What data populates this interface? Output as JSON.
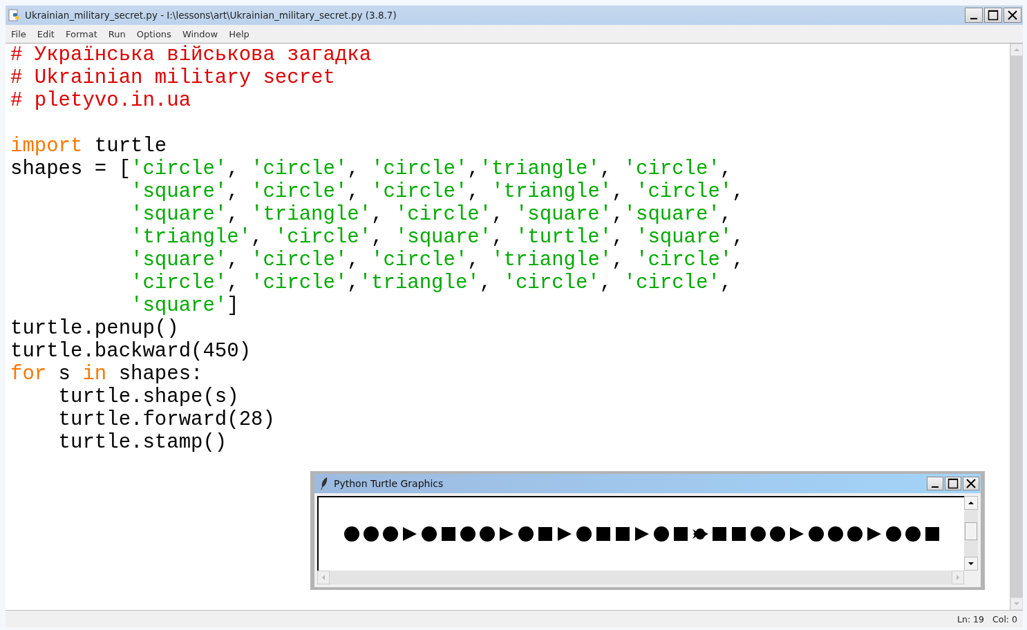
{
  "window": {
    "title": "Ukrainian_military_secret.py - I:\\lessons\\art\\Ukrainian_military_secret.py (3.8.7)"
  },
  "menu": [
    {
      "label": "File"
    },
    {
      "label": "Edit"
    },
    {
      "label": "Format"
    },
    {
      "label": "Run"
    },
    {
      "label": "Options"
    },
    {
      "label": "Window"
    },
    {
      "label": "Help"
    }
  ],
  "editor": {
    "lines": [
      {
        "kind": "code",
        "tokens": [
          {
            "kind": "comment",
            "text": "# Українська військова загадка"
          }
        ]
      },
      {
        "kind": "code",
        "tokens": [
          {
            "kind": "comment",
            "text": "# Ukrainian military secret"
          }
        ]
      },
      {
        "kind": "code",
        "tokens": [
          {
            "kind": "comment",
            "text": "# pletyvo.in.ua"
          }
        ]
      },
      {
        "kind": "blank"
      },
      {
        "kind": "code",
        "tokens": [
          {
            "kind": "keyword",
            "text": "import"
          },
          {
            "kind": "plain",
            "text": " turtle"
          }
        ]
      },
      {
        "kind": "code",
        "tokens": [
          {
            "kind": "plain",
            "text": "shapes = ["
          },
          {
            "kind": "string",
            "text": "'circle'"
          },
          {
            "kind": "plain",
            "text": ", "
          },
          {
            "kind": "string",
            "text": "'circle'"
          },
          {
            "kind": "plain",
            "text": ", "
          },
          {
            "kind": "string",
            "text": "'circle'"
          },
          {
            "kind": "plain",
            "text": ","
          },
          {
            "kind": "string",
            "text": "'triangle'"
          },
          {
            "kind": "plain",
            "text": ", "
          },
          {
            "kind": "string",
            "text": "'circle'"
          },
          {
            "kind": "plain",
            "text": ","
          }
        ]
      },
      {
        "kind": "continuation",
        "tokens": [
          {
            "kind": "string",
            "text": "'square'"
          },
          {
            "kind": "plain",
            "text": ", "
          },
          {
            "kind": "string",
            "text": "'circle'"
          },
          {
            "kind": "plain",
            "text": ", "
          },
          {
            "kind": "string",
            "text": "'circle'"
          },
          {
            "kind": "plain",
            "text": ", "
          },
          {
            "kind": "string",
            "text": "'triangle'"
          },
          {
            "kind": "plain",
            "text": ", "
          },
          {
            "kind": "string",
            "text": "'circle'"
          },
          {
            "kind": "plain",
            "text": ","
          }
        ]
      },
      {
        "kind": "continuation",
        "tokens": [
          {
            "kind": "string",
            "text": "'square'"
          },
          {
            "kind": "plain",
            "text": ", "
          },
          {
            "kind": "string",
            "text": "'triangle'"
          },
          {
            "kind": "plain",
            "text": ", "
          },
          {
            "kind": "string",
            "text": "'circle'"
          },
          {
            "kind": "plain",
            "text": ", "
          },
          {
            "kind": "string",
            "text": "'square'"
          },
          {
            "kind": "plain",
            "text": ","
          },
          {
            "kind": "string",
            "text": "'square'"
          },
          {
            "kind": "plain",
            "text": ","
          }
        ]
      },
      {
        "kind": "continuation",
        "tokens": [
          {
            "kind": "string",
            "text": "'triangle'"
          },
          {
            "kind": "plain",
            "text": ", "
          },
          {
            "kind": "string",
            "text": "'circle'"
          },
          {
            "kind": "plain",
            "text": ", "
          },
          {
            "kind": "string",
            "text": "'square'"
          },
          {
            "kind": "plain",
            "text": ", "
          },
          {
            "kind": "string",
            "text": "'turtle'"
          },
          {
            "kind": "plain",
            "text": ", "
          },
          {
            "kind": "string",
            "text": "'square'"
          },
          {
            "kind": "plain",
            "text": ","
          }
        ]
      },
      {
        "kind": "continuation",
        "tokens": [
          {
            "kind": "string",
            "text": "'square'"
          },
          {
            "kind": "plain",
            "text": ", "
          },
          {
            "kind": "string",
            "text": "'circle'"
          },
          {
            "kind": "plain",
            "text": ", "
          },
          {
            "kind": "string",
            "text": "'circle'"
          },
          {
            "kind": "plain",
            "text": ", "
          },
          {
            "kind": "string",
            "text": "'triangle'"
          },
          {
            "kind": "plain",
            "text": ", "
          },
          {
            "kind": "string",
            "text": "'circle'"
          },
          {
            "kind": "plain",
            "text": ","
          }
        ]
      },
      {
        "kind": "continuation",
        "tokens": [
          {
            "kind": "string",
            "text": "'circle'"
          },
          {
            "kind": "plain",
            "text": ", "
          },
          {
            "kind": "string",
            "text": "'circle'"
          },
          {
            "kind": "plain",
            "text": ","
          },
          {
            "kind": "string",
            "text": "'triangle'"
          },
          {
            "kind": "plain",
            "text": ", "
          },
          {
            "kind": "string",
            "text": "'circle'"
          },
          {
            "kind": "plain",
            "text": ", "
          },
          {
            "kind": "string",
            "text": "'circle'"
          },
          {
            "kind": "plain",
            "text": ","
          }
        ]
      },
      {
        "kind": "continuation",
        "tokens": [
          {
            "kind": "string",
            "text": "'square'"
          },
          {
            "kind": "plain",
            "text": "]"
          }
        ]
      },
      {
        "kind": "code",
        "tokens": [
          {
            "kind": "plain",
            "text": "turtle.penup()"
          }
        ]
      },
      {
        "kind": "code",
        "tokens": [
          {
            "kind": "plain",
            "text": "turtle.backward(450)"
          }
        ]
      },
      {
        "kind": "code",
        "tokens": [
          {
            "kind": "keyword",
            "text": "for"
          },
          {
            "kind": "plain",
            "text": " s "
          },
          {
            "kind": "keyword",
            "text": "in"
          },
          {
            "kind": "plain",
            "text": " shapes:"
          }
        ]
      },
      {
        "kind": "code",
        "tokens": [
          {
            "kind": "plain",
            "text": "    turtle.shape(s)"
          }
        ]
      },
      {
        "kind": "code",
        "tokens": [
          {
            "kind": "plain",
            "text": "    turtle.forward(28)"
          }
        ]
      },
      {
        "kind": "code",
        "tokens": [
          {
            "kind": "plain",
            "text": "    turtle.stamp()"
          }
        ]
      }
    ]
  },
  "status_bar": {
    "line": "Ln: 19",
    "column": "Col: 0"
  },
  "turtle_window": {
    "title": "Python Turtle Graphics",
    "stamps": [
      {
        "kind": "circle"
      },
      {
        "kind": "circle"
      },
      {
        "kind": "circle"
      },
      {
        "kind": "triangle"
      },
      {
        "kind": "circle"
      },
      {
        "kind": "square"
      },
      {
        "kind": "circle"
      },
      {
        "kind": "circle"
      },
      {
        "kind": "triangle"
      },
      {
        "kind": "circle"
      },
      {
        "kind": "square"
      },
      {
        "kind": "triangle"
      },
      {
        "kind": "circle"
      },
      {
        "kind": "square"
      },
      {
        "kind": "square"
      },
      {
        "kind": "triangle"
      },
      {
        "kind": "circle"
      },
      {
        "kind": "square"
      },
      {
        "kind": "turtle"
      },
      {
        "kind": "square"
      },
      {
        "kind": "square"
      },
      {
        "kind": "circle"
      },
      {
        "kind": "circle"
      },
      {
        "kind": "triangle"
      },
      {
        "kind": "circle"
      },
      {
        "kind": "circle"
      },
      {
        "kind": "circle"
      },
      {
        "kind": "triangle"
      },
      {
        "kind": "circle"
      },
      {
        "kind": "circle"
      },
      {
        "kind": "square"
      }
    ]
  }
}
